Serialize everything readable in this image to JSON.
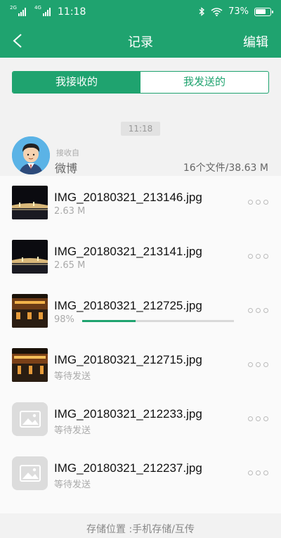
{
  "status_bar": {
    "sim1_tag": "2G",
    "sim2_tag": "4G",
    "time": "11:18",
    "battery": "73%",
    "battery_level": 0.73,
    "icons": [
      "bluetooth-icon",
      "wifi-icon",
      "battery-icon"
    ]
  },
  "app_bar": {
    "title": "记录",
    "edit_label": "编辑",
    "back_icon": "back-arrow-icon"
  },
  "tabs": [
    {
      "label": "我接收的",
      "active": true
    },
    {
      "label": "我发送的",
      "active": false
    }
  ],
  "time_chip": "11:18",
  "sender": {
    "subtitle": "接收自",
    "name": "微博",
    "summary": "16个文件/38.63 M"
  },
  "files": [
    {
      "name": "IMG_20180321_213146.jpg",
      "sub": "2.63 M",
      "thumb": "bridge-night"
    },
    {
      "name": "IMG_20180321_213141.jpg",
      "sub": "2.65 M",
      "thumb": "bridge-night"
    },
    {
      "name": "IMG_20180321_212725.jpg",
      "sub": "98%",
      "thumb": "street-night",
      "progress": 0.35
    },
    {
      "name": "IMG_20180321_212715.jpg",
      "sub": "等待发送",
      "thumb": "street-night"
    },
    {
      "name": "IMG_20180321_212233.jpg",
      "sub": "等待发送",
      "thumb": "placeholder"
    },
    {
      "name": "IMG_20180321_212237.jpg",
      "sub": "等待发送",
      "thumb": "placeholder"
    }
  ],
  "footer": "存储位置 :手机存储/互传",
  "colors": {
    "accent": "#1fa36f"
  }
}
